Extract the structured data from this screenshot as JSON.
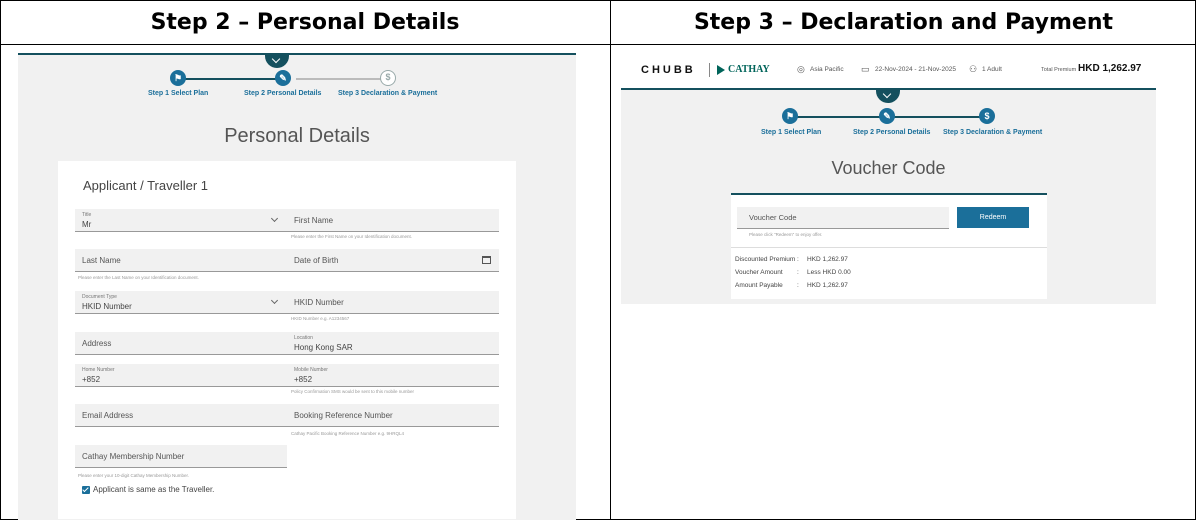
{
  "headers": {
    "left": "Step 2 – Personal Details",
    "right": "Step 3 – Declaration and Payment"
  },
  "left_panel": {
    "steps": [
      {
        "label": "Step 1 Select Plan",
        "icon": "flag-icon"
      },
      {
        "label": "Step 2 Personal Details",
        "icon": "edit-icon"
      },
      {
        "label": "Step 3 Declaration & Payment",
        "icon": "dollar-icon"
      }
    ],
    "title": "Personal Details",
    "card_heading": "Applicant / Traveller 1",
    "fields": {
      "title_label": "Title",
      "title_value": "Mr",
      "first_name": "First Name",
      "first_name_hint": "Please enter the First Name on your Identification document.",
      "last_name": "Last Name",
      "last_name_hint": "Please enter the Last Name on your Identification document.",
      "dob": "Date of Birth",
      "doc_type_label": "Document Type",
      "doc_type_value": "HKID Number",
      "hkid": "HKID Number",
      "hkid_hint": "HKID Number e.g. A1234567",
      "address": "Address",
      "location_label": "Location",
      "location_value": "Hong Kong SAR",
      "home_label": "Home Number",
      "home_value": "+852",
      "mobile_label": "Mobile Number",
      "mobile_value": "+852",
      "mobile_hint": "Policy Confirmation SMS would be sent to this mobile number",
      "email": "Email Address",
      "booking_ref": "Booking Reference Number",
      "booking_hint": "Cathay Pacific Booking Reference Number e.g. 9HRQL4",
      "membership": "Cathay Membership Number",
      "membership_hint": "Please enter your 10-digit Cathay Membership Number."
    },
    "checkbox_label": "Applicant is same as the Traveller."
  },
  "right_panel": {
    "brand_chubb": "CHUBB",
    "brand_cathay": "CATHAY",
    "region": "Asia Pacific",
    "dates": "22-Nov-2024 - 21-Nov-2025",
    "travellers": "1 Adult",
    "premium_label": "Total Premium",
    "premium_value": "HKD 1,262.97",
    "steps": [
      {
        "label": "Step 1 Select Plan"
      },
      {
        "label": "Step 2 Personal Details"
      },
      {
        "label": "Step 3 Declaration & Payment"
      }
    ],
    "title": "Voucher Code",
    "voucher_placeholder": "Voucher Code",
    "voucher_hint": "Please click \"Redeem\" to enjoy offer.",
    "redeem_label": "Redeem",
    "summary": [
      {
        "key": "Discounted Premium",
        "value": "HKD 1,262.97"
      },
      {
        "key": "Voucher Amount",
        "value": "Less HKD 0.00"
      },
      {
        "key": "Amount Payable",
        "value": "HKD 1,262.97"
      }
    ]
  },
  "colors": {
    "primary": "#1b6f9a",
    "dark_teal": "#14505e",
    "cathay_green": "#00645a"
  }
}
